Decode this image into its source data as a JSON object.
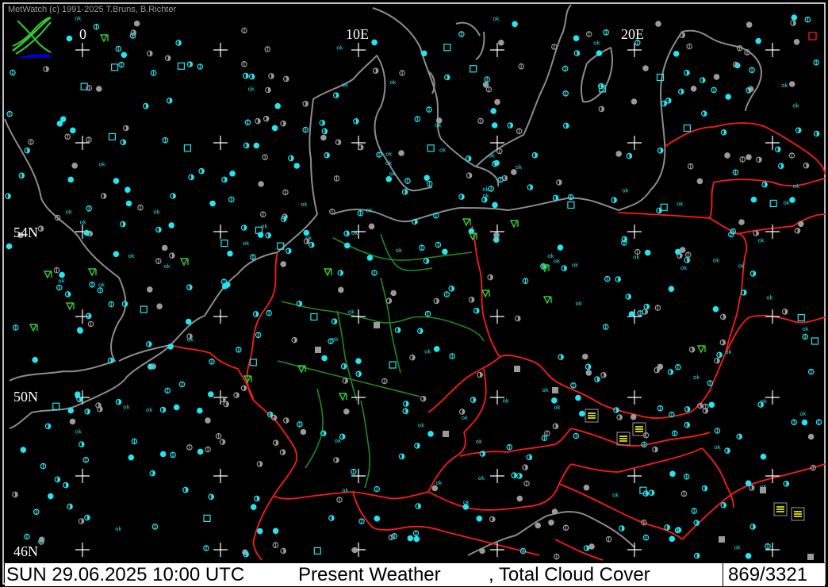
{
  "app": {
    "credit": "MetWatch  (c) 1991-2025 T.Bruns, B.Richter"
  },
  "grid_labels": {
    "lon_0": "0",
    "lon_10e": "10E",
    "lon_20e": "20E",
    "lat_54n": "54N",
    "lat_50n": "50N",
    "lat_46n": "46N"
  },
  "status": {
    "datetime": "SUN 29.06.2025 10:00 UTC",
    "layer_weather": "Present Weather",
    "layer_cloud": ", Total Cloud Cover",
    "count": "869/3321"
  },
  "colors": {
    "background": "#000000",
    "coastline": "#8c8c8c",
    "borders": "#ff1a1a",
    "states": "#1e8a1e",
    "station_cyan": "#22e6f0",
    "station_grey": "#9a9a9a",
    "weather_green": "#33cc33",
    "weather_yellow": "#ffff00",
    "grid": "#ffffff"
  },
  "icons": {
    "logo": "metwatch-logo-icon",
    "grid": "grid-cross-icon"
  }
}
